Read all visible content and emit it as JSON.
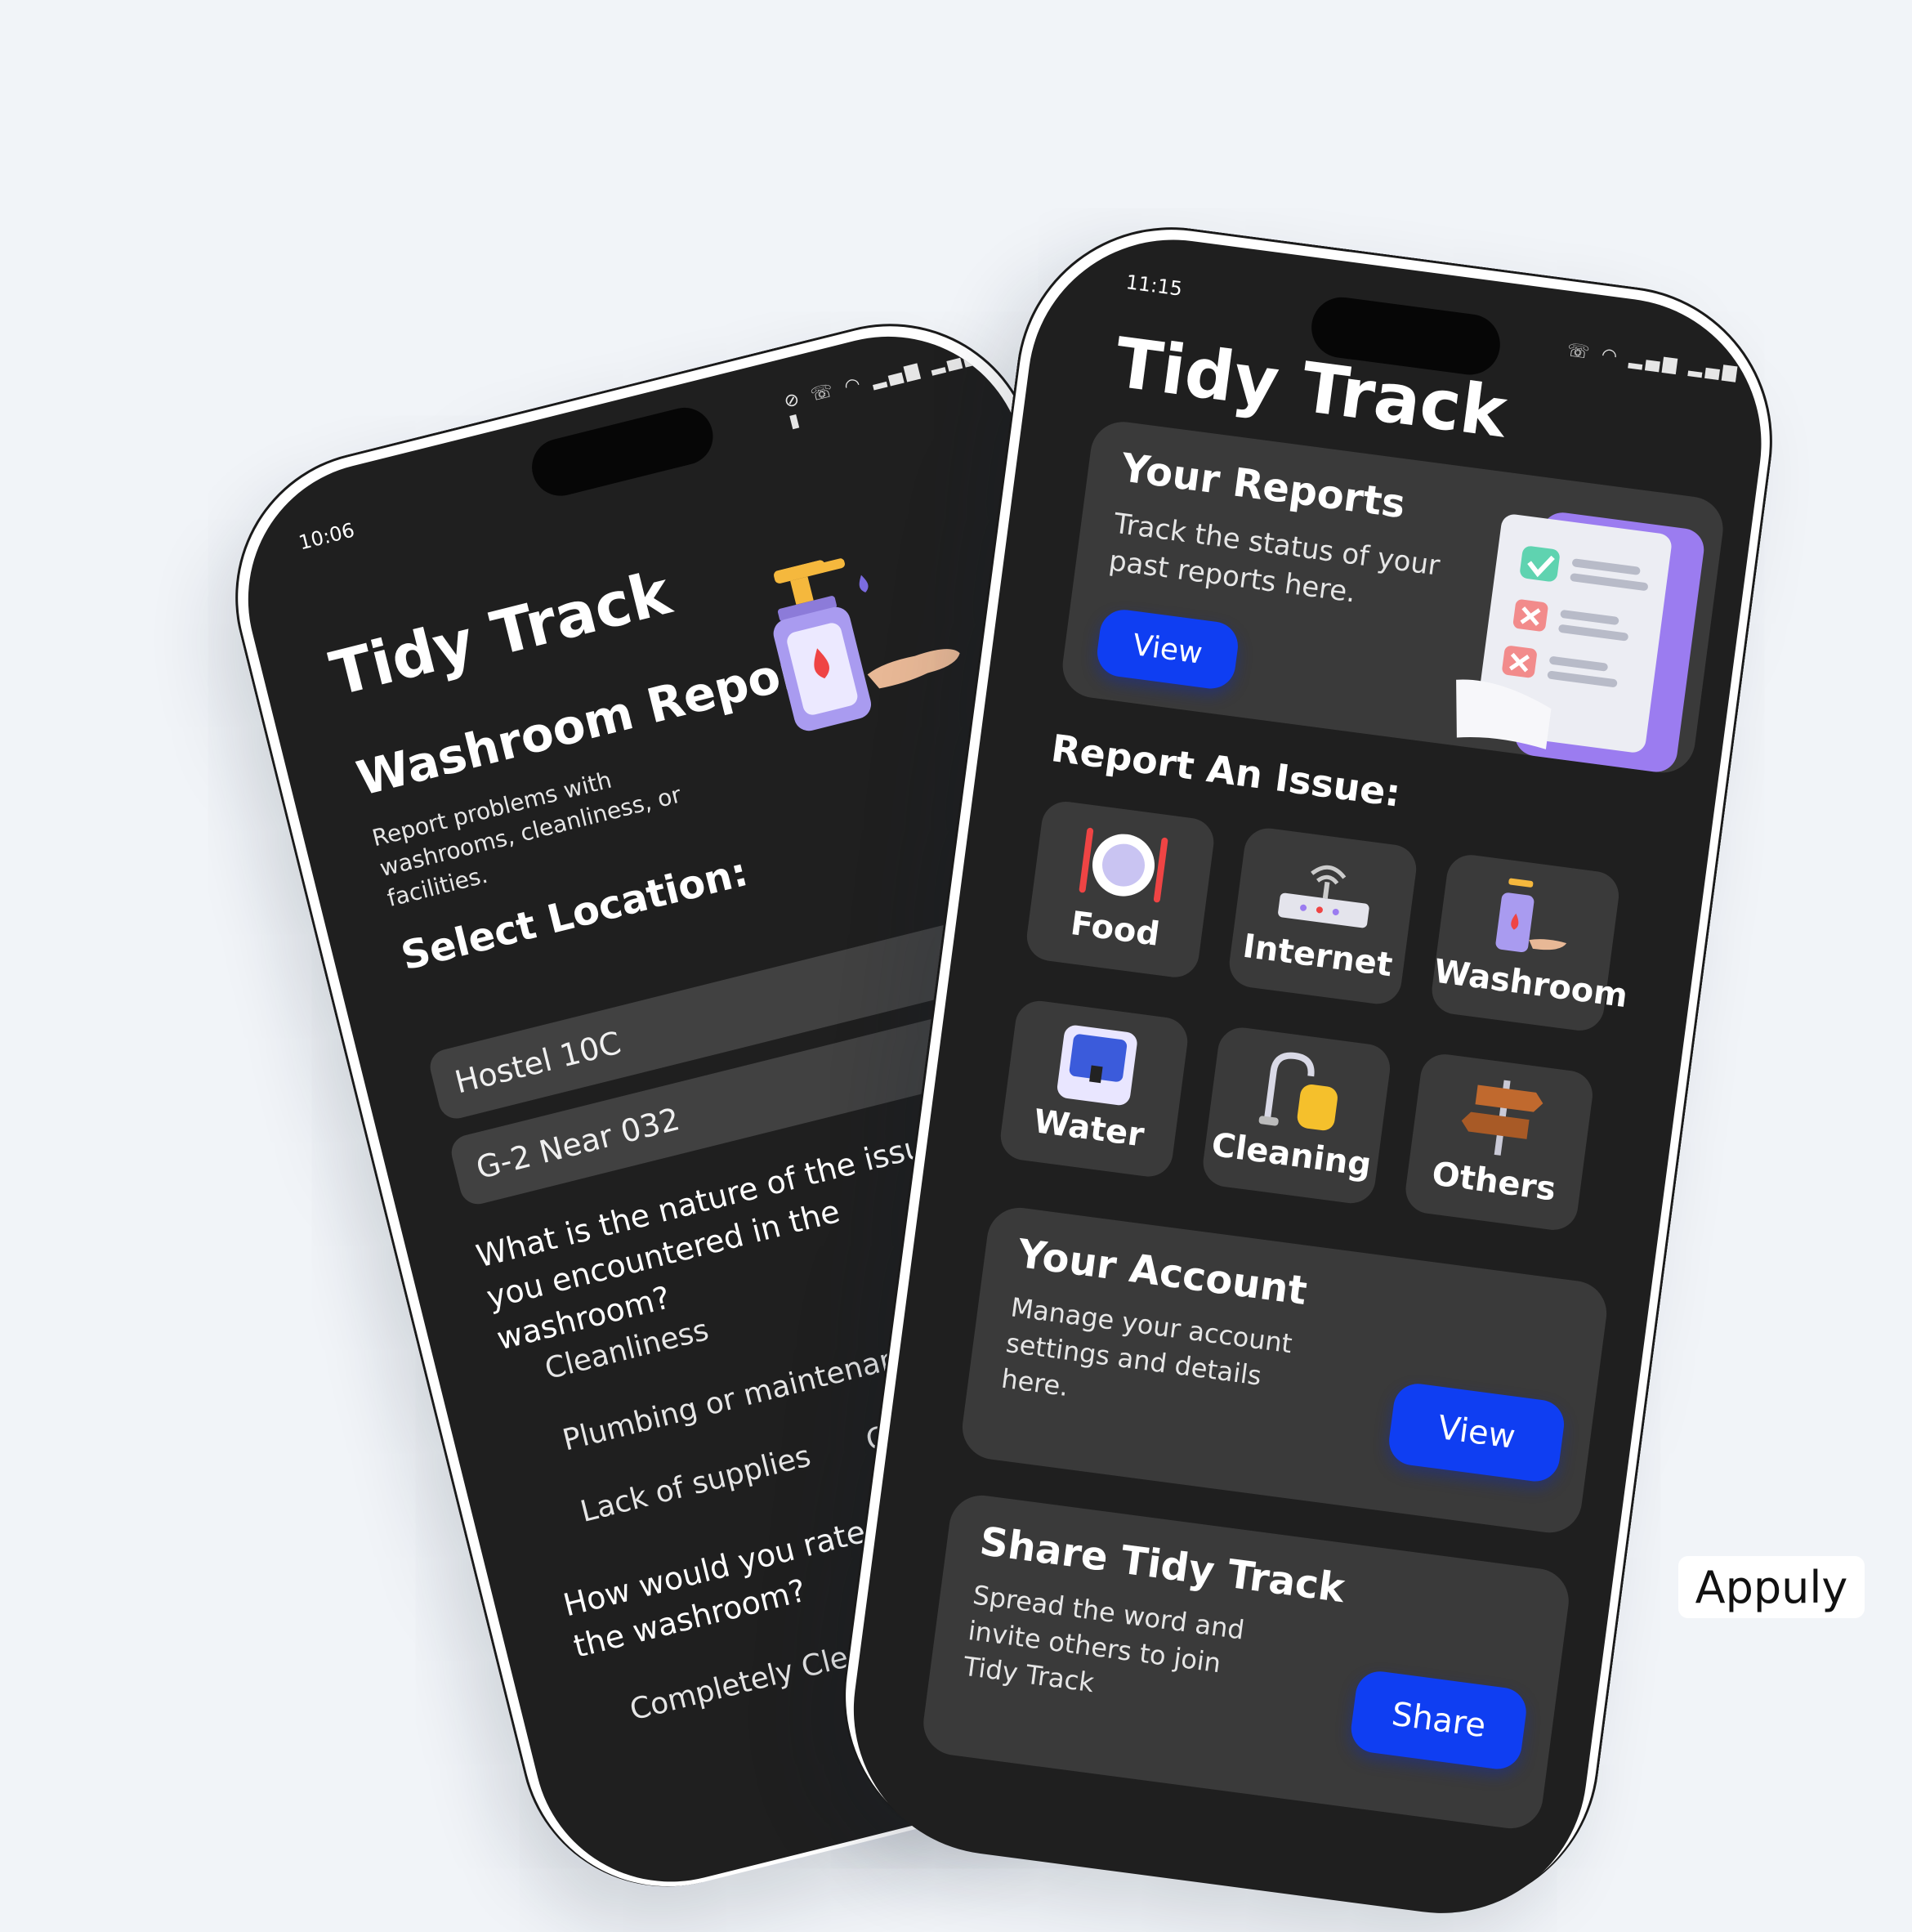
{
  "brand": "Appuly",
  "left_phone": {
    "status": {
      "time": "10:06",
      "icons": "⊘ ☏ ◠ ▂▄▆ ▂▄▆ ▮"
    },
    "app_title": "Tidy Track",
    "form_title": "Washroom Report:",
    "description": "Report problems with washrooms, cleanliness, or facilities.",
    "select_label": "Select Location:",
    "dropdown_value": "",
    "locations": [
      "Hostel 10C",
      "G-2 Near 032"
    ],
    "question_1": "What is the nature of the issue you encountered in the washroom?",
    "issue_options": [
      "Cleanliness",
      "Plumbing or maintenance",
      "Lack of supplies",
      "Other"
    ],
    "question_2": "How would you rate the the washroom?",
    "rating_option": "Completely Clean"
  },
  "right_phone": {
    "status": {
      "time": "11:15",
      "icons": "☏ ◠ ▂▄▆ ▂▄▆ ▮"
    },
    "app_title": "Tidy Track",
    "reports_card": {
      "title": "Your Reports",
      "text": "Track the status of your past reports here.",
      "button": "View"
    },
    "section_title": "Report An Issue:",
    "categories": [
      {
        "label": "Food",
        "icon": "plate-cutlery-icon"
      },
      {
        "label": "Internet",
        "icon": "router-icon"
      },
      {
        "label": "Washroom",
        "icon": "soap-dispenser-icon"
      },
      {
        "label": "Water",
        "icon": "water-cooler-icon"
      },
      {
        "label": "Cleaning",
        "icon": "vacuum-cleaner-icon"
      },
      {
        "label": "Others",
        "icon": "signpost-icon"
      }
    ],
    "account_card": {
      "title": "Your Account",
      "text": "Manage your account settings and details here.",
      "button": "View"
    },
    "share_card": {
      "title": "Share Tidy Track",
      "text": "Spread the word and invite others to join Tidy Track",
      "button": "Share"
    }
  },
  "colors": {
    "background": "#f1f4f8",
    "screen": "#1f1f1f",
    "card": "#3a3a3a",
    "field": "#414141",
    "button": "#0f3ef2",
    "accent_purple": "#9b7cf0"
  }
}
